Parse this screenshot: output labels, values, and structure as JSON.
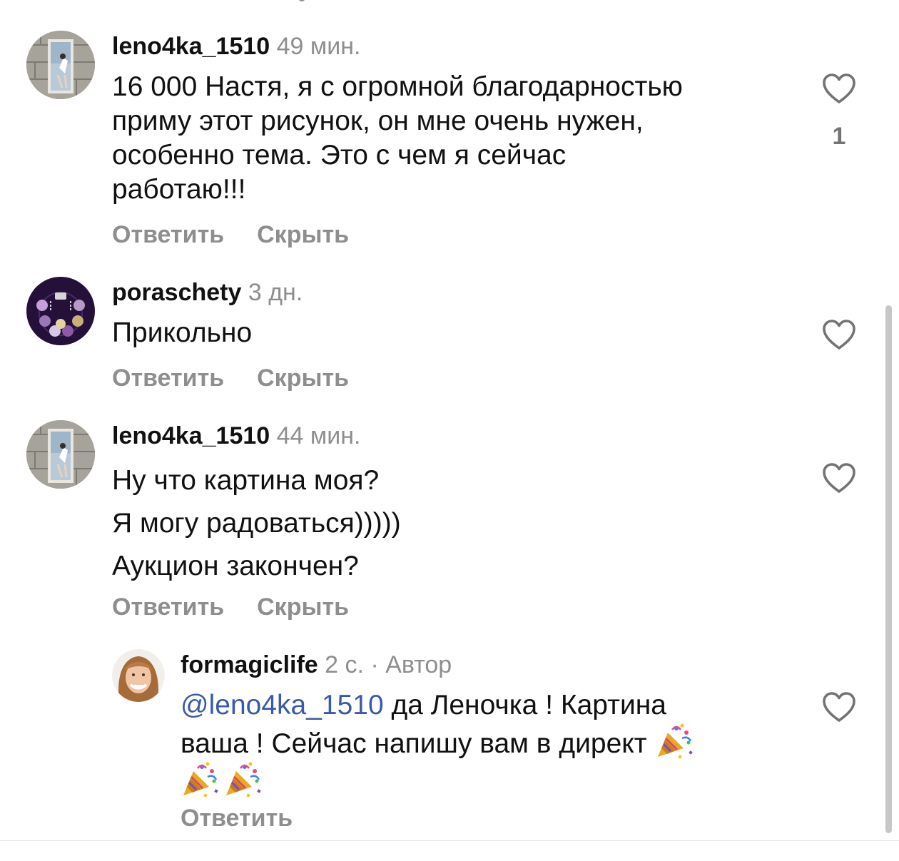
{
  "comments": [
    {
      "username": "leno4ka_1510",
      "time": "49 мин.",
      "text_lines": [
        "16 000  Настя, я с огромной благодарностью",
        "приму этот рисунок, он мне очень нужен,",
        "особенно тема. Это с чем я сейчас",
        "работаю!!!"
      ],
      "likes": "1",
      "reply_label": "Ответить",
      "hide_label": "Скрыть"
    },
    {
      "username": "poraschety",
      "time": "3 дн.",
      "text_lines": [
        "Прикольно"
      ],
      "reply_label": "Ответить",
      "hide_label": "Скрыть"
    },
    {
      "username": "leno4ka_1510",
      "time": "44 мин.",
      "text_lines": [
        "Ну что картина моя?",
        "Я могу радоваться)))))",
        "Аукцион закончен?"
      ],
      "reply_label": "Ответить",
      "hide_label": "Скрыть"
    }
  ],
  "reply": {
    "username": "formagiclife",
    "time": "2 с.",
    "author_label": "· Автор",
    "mention": "@leno4ka_1510",
    "text_line1": " да Леночка ! Картина",
    "text_line2": "ваша ! Сейчас напишу вам в директ ",
    "emoji": "party-popper-icon",
    "reply_label": "Ответить"
  },
  "colors": {
    "secondary_text": "#8e8e8e",
    "mention": "#3a5aa8",
    "primary_text": "#111111"
  }
}
